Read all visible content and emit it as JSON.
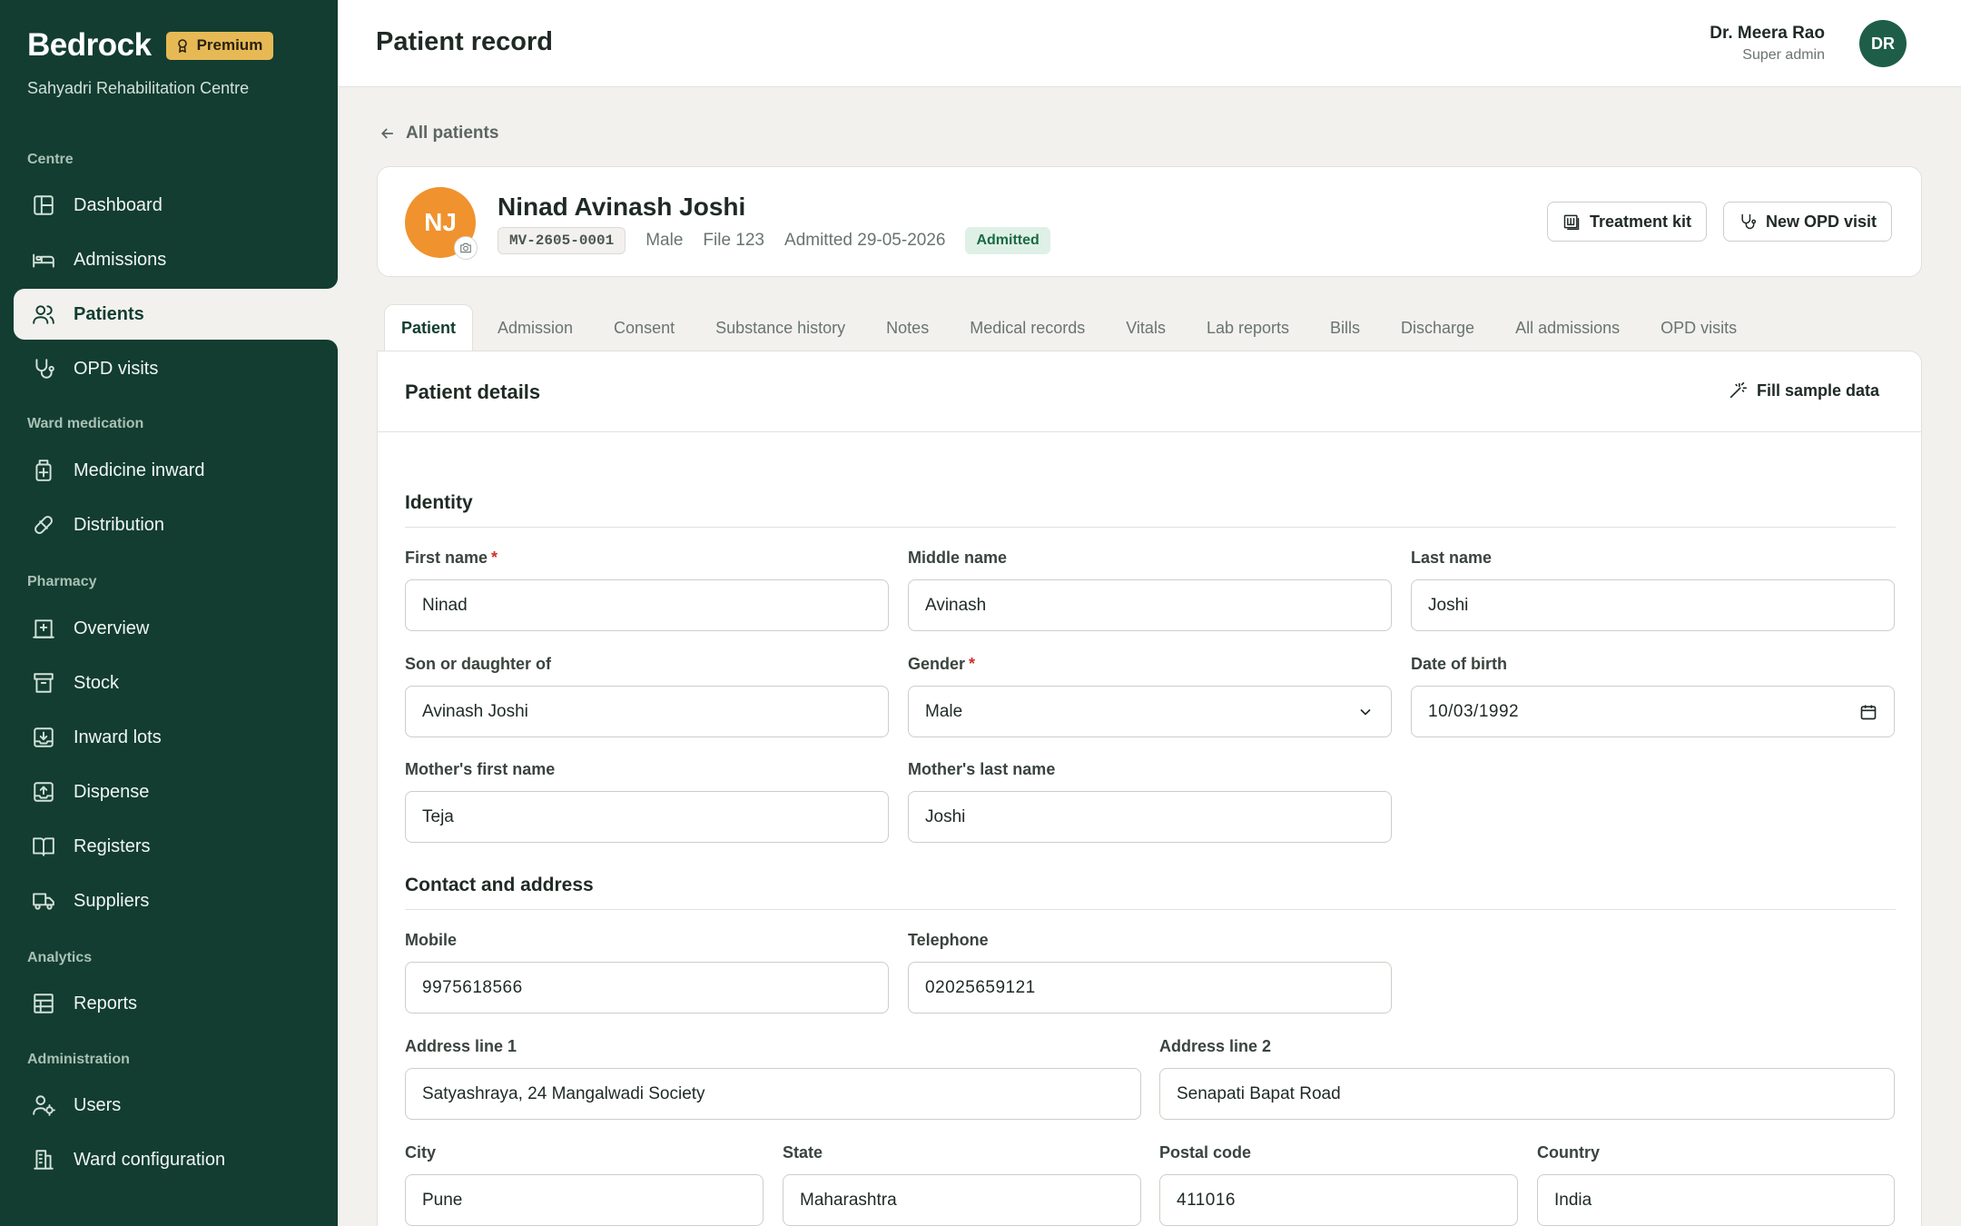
{
  "sidebar": {
    "brand": "Bedrock",
    "premium_label": "Premium",
    "centre": "Sahyadri Rehabilitation Centre",
    "sections": {
      "centre": "Centre",
      "ward_medication": "Ward medication",
      "pharmacy": "Pharmacy",
      "analytics": "Analytics",
      "administration": "Administration"
    },
    "items": {
      "dashboard": "Dashboard",
      "admissions": "Admissions",
      "patients": "Patients",
      "opd_visits": "OPD visits",
      "medicine_inward": "Medicine inward",
      "distribution": "Distribution",
      "overview": "Overview",
      "stock": "Stock",
      "inward_lots": "Inward lots",
      "dispense": "Dispense",
      "registers": "Registers",
      "suppliers": "Suppliers",
      "reports": "Reports",
      "users": "Users",
      "ward_configuration": "Ward configuration"
    },
    "active_item": "Patients"
  },
  "header": {
    "title": "Patient record",
    "user_name": "Dr. Meera Rao",
    "user_role": "Super admin",
    "user_initials": "DR"
  },
  "back_link": "All patients",
  "patient": {
    "initials": "NJ",
    "name": "Ninad Avinash Joshi",
    "mrn": "MV-2605-0001",
    "gender": "Male",
    "file": "File 123",
    "admitted": "Admitted 29-05-2026",
    "status": "Admitted",
    "status_color": "#1a6b43"
  },
  "actions": {
    "treatment_kit": "Treatment kit",
    "new_opd_visit": "New OPD visit"
  },
  "tabs": [
    "Patient",
    "Admission",
    "Consent",
    "Substance history",
    "Notes",
    "Medical records",
    "Vitals",
    "Lab reports",
    "Bills",
    "Discharge",
    "All admissions",
    "OPD visits"
  ],
  "panel": {
    "title": "Patient details",
    "fill_sample": "Fill sample data"
  },
  "identity": {
    "title": "Identity",
    "first_name": {
      "label": "First name",
      "value": "Ninad"
    },
    "middle_name": {
      "label": "Middle name",
      "value": "Avinash"
    },
    "last_name": {
      "label": "Last name",
      "value": "Joshi"
    },
    "son_daughter_of": {
      "label": "Son or daughter of",
      "value": "Avinash Joshi"
    },
    "gender": {
      "label": "Gender",
      "value": "Male"
    },
    "dob": {
      "label": "Date of birth",
      "value": "10/03/1992"
    },
    "mother_first": {
      "label": "Mother's first name",
      "value": "Teja"
    },
    "mother_last": {
      "label": "Mother's last name",
      "value": "Joshi"
    }
  },
  "contact": {
    "title": "Contact and address",
    "mobile": {
      "label": "Mobile",
      "value": "9975618566"
    },
    "telephone": {
      "label": "Telephone",
      "value": "02025659121"
    },
    "address1": {
      "label": "Address line 1",
      "value": "Satyashraya, 24 Mangalwadi Society"
    },
    "address2": {
      "label": "Address line 2",
      "value": "Senapati Bapat Road"
    },
    "city": {
      "label": "City",
      "value": "Pune"
    },
    "state": {
      "label": "State",
      "value": "Maharashtra"
    },
    "postal": {
      "label": "Postal code",
      "value": "411016"
    },
    "country": {
      "label": "Country",
      "value": "India"
    }
  },
  "required_mark": "*"
}
